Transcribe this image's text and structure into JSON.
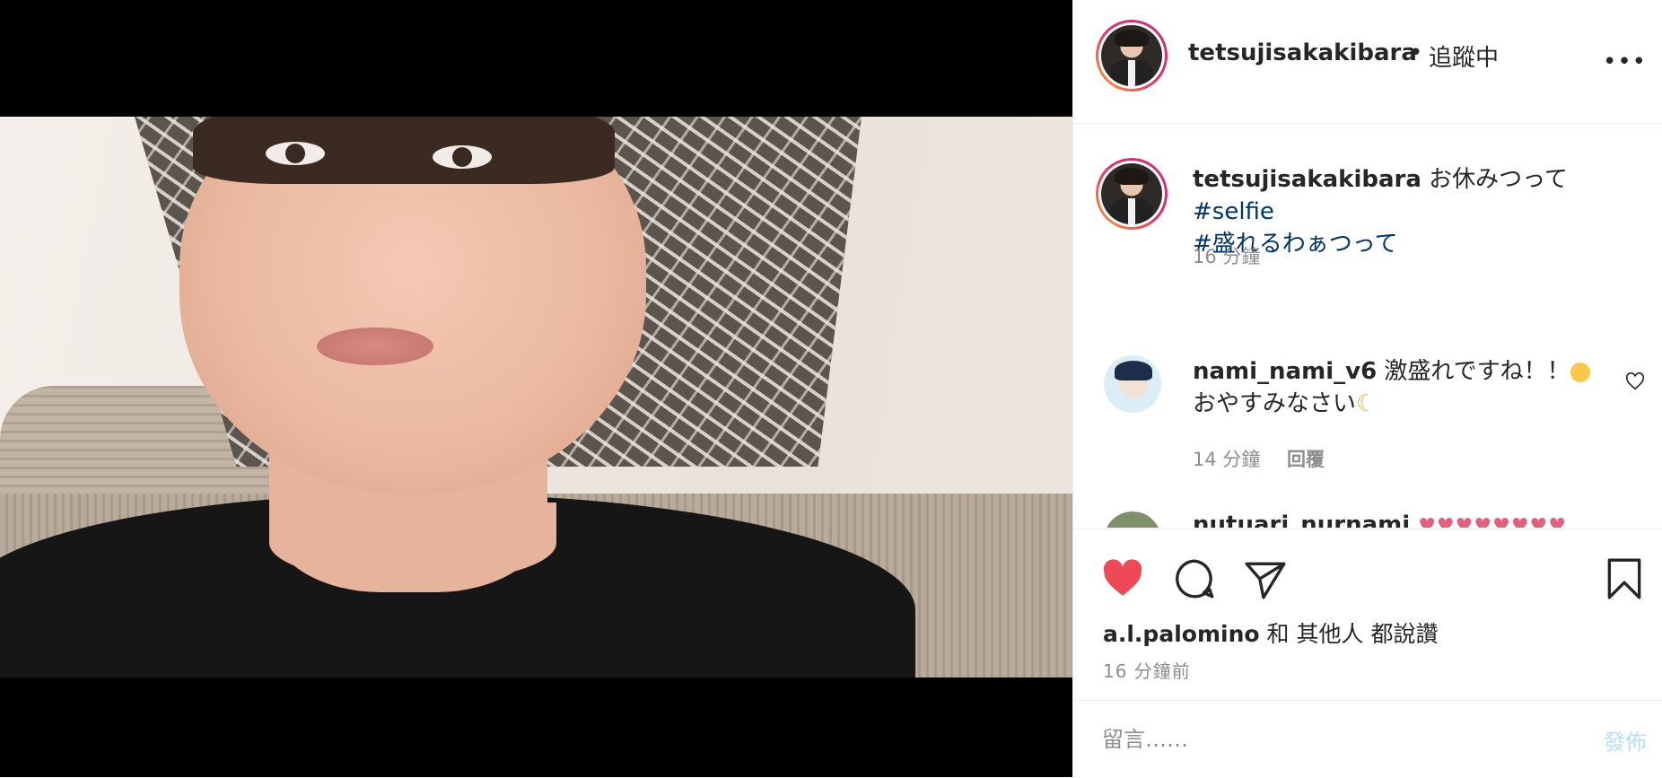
{
  "post": {
    "image_alt": "selfie photo"
  },
  "header": {
    "username": "tetsujisakakibara",
    "dot": "•",
    "follow_status": "追蹤中",
    "more_label": "•••"
  },
  "caption": {
    "username": "tetsujisakakibara",
    "text": "お休みつって",
    "tags": [
      "#selfie",
      "#盛れるわぁつって"
    ],
    "time": "16 分鐘"
  },
  "comments": [
    {
      "username": "nami_nami_v6",
      "text_line1": "激盛れですね！！",
      "text_line2": "おやすみなさい",
      "time": "14 分鐘",
      "reply_label": "回覆"
    },
    {
      "username": "nutuari_nurnami",
      "hearts": "♥♥♥♥♥♥♥♥"
    }
  ],
  "likes": {
    "user": "a.l.palomino",
    "and": "和",
    "others": "其他人",
    "suffix": "都說讚"
  },
  "posted_ago": "16 分鐘前",
  "comment_box": {
    "placeholder": "留言……",
    "post_label": "發佈"
  },
  "colors": {
    "like_red": "#ed4956",
    "hashtag_blue": "#003569",
    "post_button_disabled": "#b2dffc",
    "muted_gray": "#8e8e8e"
  }
}
